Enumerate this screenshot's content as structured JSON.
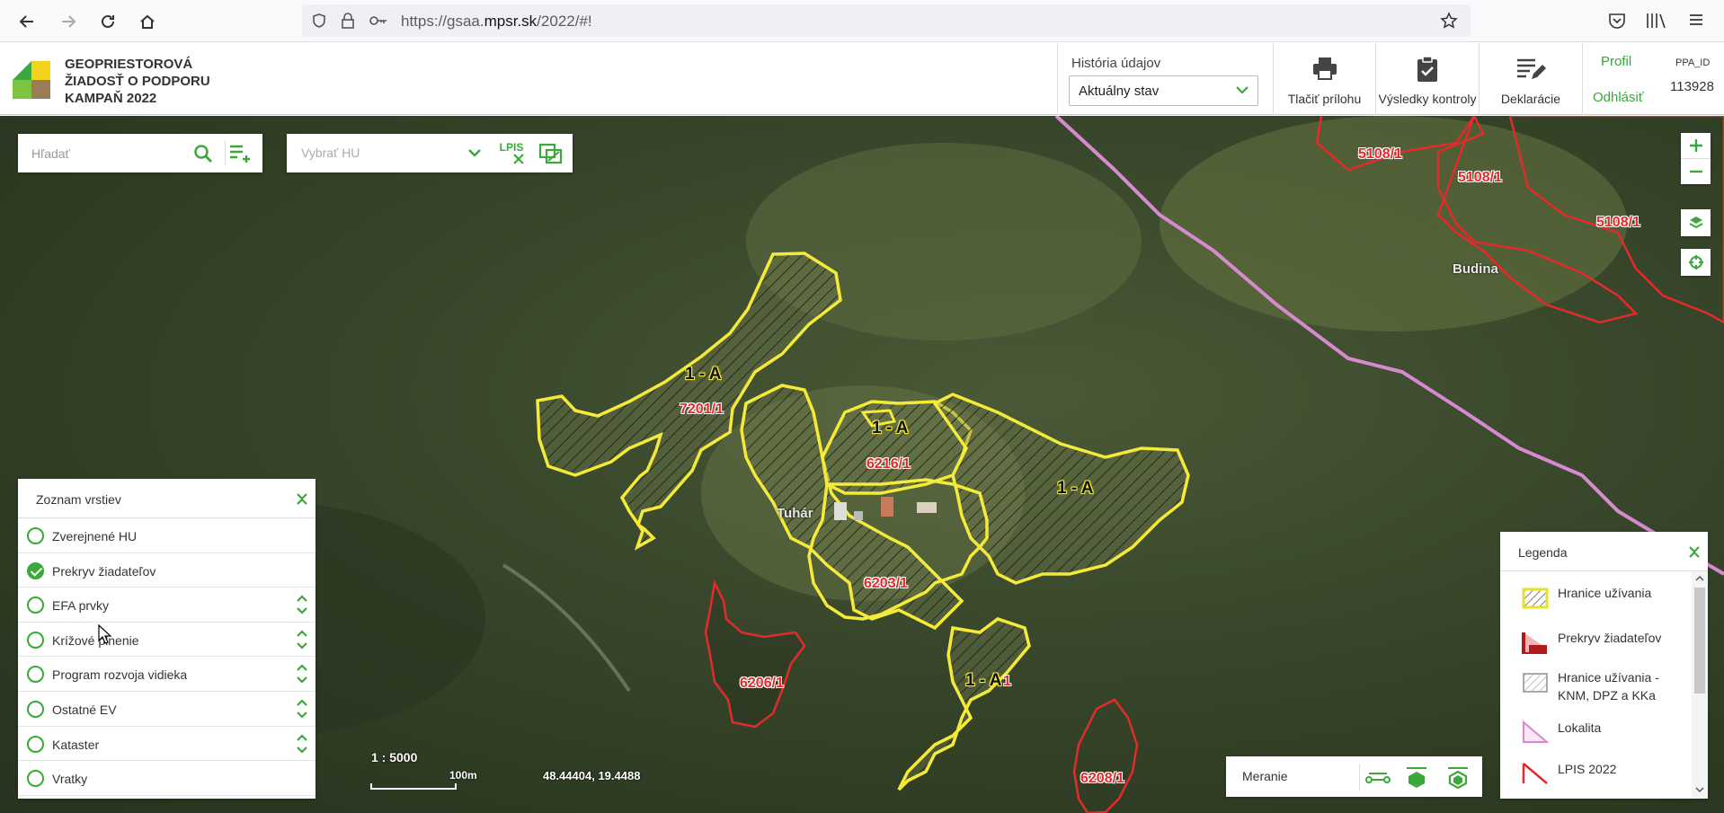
{
  "browser": {
    "url_prefix": "https://gsaa.",
    "url_host": "mpsr.sk",
    "url_path": "/2022/#!"
  },
  "header": {
    "brand_line1": "GEOPRIESTOROVÁ",
    "brand_line2": "ŽIADOSŤ O PODPORU",
    "brand_line3": "KAMPAŇ 2022",
    "history_label": "História údajov",
    "history_value": "Aktuálny stav",
    "tools": {
      "print": "Tlačiť prílohu",
      "results": "Výsledky kontroly",
      "declarations": "Deklarácie"
    },
    "profile_link": "Profil",
    "logout_link": "Odhlásiť",
    "ppa_label": "PPA_ID",
    "ppa_value": "113928"
  },
  "map_tools": {
    "search_placeholder": "Hľadať",
    "hu_placeholder": "Vybrať HU",
    "lpis_label": "LPIS"
  },
  "layers": {
    "title": "Zoznam vrstiev",
    "items": [
      {
        "label": "Zverejnené HU",
        "checked": false,
        "reorder": false
      },
      {
        "label": "Prekryv žiadateľov",
        "checked": true,
        "reorder": false
      },
      {
        "label": "EFA prvky",
        "checked": false,
        "reorder": true
      },
      {
        "label": "Krížové plnenie",
        "checked": false,
        "reorder": true
      },
      {
        "label": "Program rozvoja vidieka",
        "checked": false,
        "reorder": true
      },
      {
        "label": "Ostatné EV",
        "checked": false,
        "reorder": true
      },
      {
        "label": "Kataster",
        "checked": false,
        "reorder": true
      },
      {
        "label": "Vratky",
        "checked": false,
        "reorder": false
      }
    ]
  },
  "legend": {
    "title": "Legenda",
    "items": [
      "Hranice užívania",
      "Prekryv žiadateľov",
      "Hranice užívania - KNM, DPZ a KKa",
      "Lokalita",
      "LPIS 2022"
    ]
  },
  "measure": {
    "label": "Meranie"
  },
  "map_info": {
    "scale": "1 : 5000",
    "scale_length": "100m",
    "coordinates": "48.44404, 19.4488"
  },
  "map_labels": {
    "block_a1": "1 - A",
    "block_a2": "1 - A",
    "block_a3": "1 - A",
    "block_a4": "1 - A",
    "parcel_7201": "7201/1",
    "parcel_6216": "6216/1",
    "parcel_6203": "6203/1",
    "parcel_6206": "6206/1",
    "parcel_1a1": "1",
    "parcel_6208": "6208/1",
    "parcel_5108a": "5108/1",
    "parcel_5108b": "5108/1",
    "parcel_5108c": "5108/1",
    "place_budina": "Budina",
    "place_tuhar": "Tuhár"
  },
  "colors": {
    "accent": "#3aa83a",
    "boundary": "#f5ea3a",
    "overlap": "#e32b2b",
    "locality": "#d88ad0"
  }
}
